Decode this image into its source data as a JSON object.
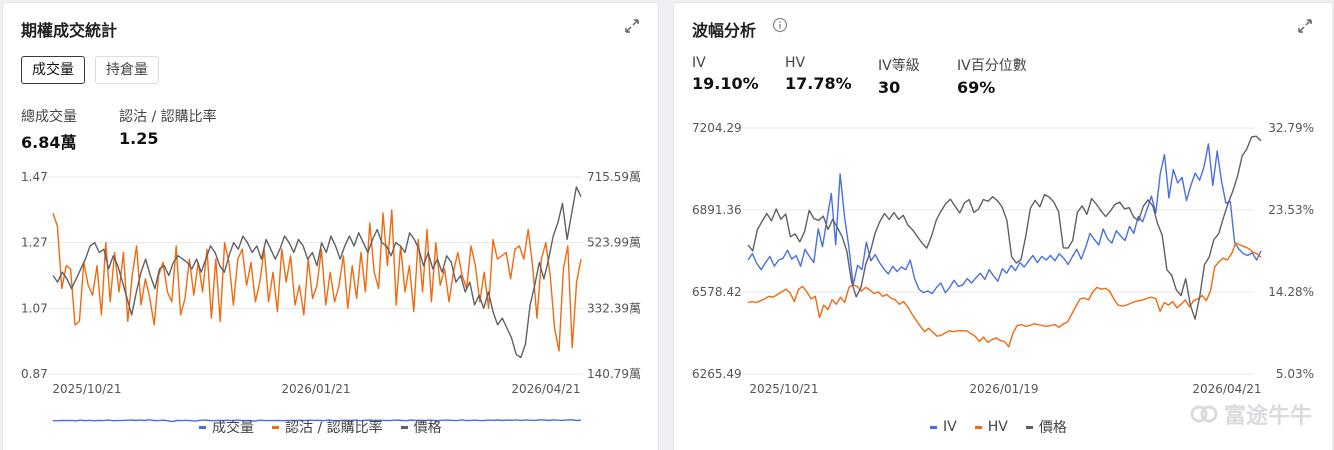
{
  "left": {
    "title": "期權成交統計",
    "tabs": [
      {
        "label": "成交量",
        "active": true
      },
      {
        "label": "持倉量",
        "active": false
      }
    ],
    "stats": [
      {
        "label": "總成交量",
        "value": "6.84萬"
      },
      {
        "label": "認沽 / 認購比率",
        "value": "1.25"
      }
    ],
    "legend": [
      "成交量",
      "認沽 / 認購比率",
      "價格"
    ]
  },
  "right": {
    "title": "波幅分析",
    "stats": [
      {
        "label": "IV",
        "value": "19.10%"
      },
      {
        "label": "HV",
        "value": "17.78%"
      },
      {
        "label": "IV等級",
        "value": "30"
      },
      {
        "label": "IV百分位數",
        "value": "69%"
      }
    ],
    "legend": [
      "IV",
      "HV",
      "價格"
    ]
  },
  "watermark": "富途牛牛",
  "colors": {
    "blue": "#4a6fe3",
    "orange": "#f06a0f",
    "gray": "#5d6166"
  },
  "chart_data": [
    {
      "type": "line",
      "x_ticks": [
        "2025/10/21",
        "2026/01/21",
        "2026/04/21"
      ],
      "y_left_ticks": [
        "1.47",
        "1.27",
        "1.07",
        "0.87"
      ],
      "y_right_ticks": [
        "715.59萬",
        "523.99萬",
        "332.39萬",
        "140.79萬"
      ],
      "series": [
        {
          "name": "成交量",
          "color": "#4a6fe3",
          "axis": "right",
          "values": [
            4.6,
            4.4,
            5.1,
            4.9,
            5.3,
            4.2,
            5.9,
            4.6,
            5.6,
            4.3,
            5.2,
            4.9,
            6.2,
            4.5,
            4.7,
            5.4,
            5.8,
            6.3,
            5.2,
            6.4,
            5.0,
            7.3,
            5.1,
            4.8,
            6.0,
            4.1,
            2.0,
            5.3,
            4.9,
            5.6,
            4.5,
            3.4,
            5.7,
            6.2,
            5.0,
            4.5,
            5.5,
            4.8,
            5.9,
            4.6,
            6.0,
            5.3,
            4.5,
            5.1,
            3.0,
            6.0,
            5.2,
            4.7,
            4.8,
            5.5,
            4.6,
            4.8,
            5.2,
            5.3,
            5.6,
            4.7,
            6.0,
            5.1,
            5.6,
            4.6,
            6.3,
            4.8,
            4.5,
            5.6,
            5.8,
            5.0,
            6.2,
            4.1,
            5.6,
            6.5,
            4.8,
            6.0,
            5.4,
            4.9,
            5.6,
            6.7,
            5.0,
            4.5,
            6.5,
            5.2,
            5.8,
            4.7,
            6.3,
            5.1,
            4.8,
            5.9,
            6.2,
            5.4,
            4.8,
            6.8,
            4.9,
            5.5,
            6.0,
            4.7,
            5.2,
            6.4,
            5.8,
            6.5,
            5.1,
            6.2,
            5.7,
            6.9,
            5.3,
            6.8,
            5.8,
            5.3,
            7.3,
            6.6,
            5.0,
            7.0,
            6.0,
            5.5,
            6.8,
            7.2,
            5.0,
            6.3
          ]
        },
        {
          "name": "認沽 / 認購比率",
          "color": "#f06a0f",
          "axis": "left",
          "values": [
            1.36,
            1.32,
            1.13,
            1.2,
            1.19,
            1.02,
            1.03,
            1.21,
            1.14,
            1.11,
            1.2,
            1.05,
            1.27,
            1.09,
            1.24,
            1.12,
            1.24,
            1.03,
            1.17,
            1.26,
            1.08,
            1.16,
            1.1,
            1.02,
            1.17,
            1.21,
            1.12,
            1.09,
            1.26,
            1.05,
            1.1,
            1.22,
            1.11,
            1.21,
            1.12,
            1.25,
            1.04,
            1.22,
            1.03,
            1.27,
            1.21,
            1.08,
            1.22,
            1.25,
            1.14,
            1.21,
            1.09,
            1.15,
            1.25,
            1.09,
            1.18,
            1.06,
            1.25,
            1.15,
            1.23,
            1.08,
            1.14,
            1.05,
            1.22,
            1.1,
            1.14,
            1.25,
            1.08,
            1.18,
            1.09,
            1.14,
            1.23,
            1.07,
            1.2,
            1.1,
            1.24,
            1.12,
            1.33,
            1.18,
            1.13,
            1.36,
            1.2,
            1.37,
            1.08,
            1.26,
            1.12,
            1.2,
            1.06,
            1.28,
            1.12,
            1.31,
            1.09,
            1.27,
            1.14,
            1.19,
            1.09,
            1.18,
            1.24,
            1.17,
            1.13,
            1.26,
            1.2,
            1.09,
            1.18,
            1.07,
            1.28,
            1.22,
            1.23,
            1.24,
            1.16,
            1.25,
            1.26,
            1.22,
            1.31,
            1.2,
            1.04,
            1.22,
            1.27,
            1.17,
            1.01,
            0.94,
            1.19,
            1.26,
            0.95,
            1.15,
            1.22
          ]
        },
        {
          "name": "價格",
          "color": "#5d6166",
          "axis": "left",
          "values": [
            1.17,
            1.15,
            1.18,
            1.16,
            1.13,
            1.16,
            1.19,
            1.22,
            1.26,
            1.27,
            1.24,
            1.25,
            1.19,
            1.23,
            1.2,
            1.15,
            1.1,
            1.05,
            1.12,
            1.18,
            1.22,
            1.17,
            1.13,
            1.19,
            1.2,
            1.17,
            1.21,
            1.23,
            1.22,
            1.21,
            1.19,
            1.22,
            1.18,
            1.22,
            1.26,
            1.24,
            1.2,
            1.18,
            1.23,
            1.27,
            1.25,
            1.29,
            1.27,
            1.24,
            1.26,
            1.22,
            1.28,
            1.25,
            1.22,
            1.25,
            1.29,
            1.27,
            1.24,
            1.28,
            1.26,
            1.22,
            1.24,
            1.2,
            1.27,
            1.24,
            1.29,
            1.26,
            1.22,
            1.26,
            1.29,
            1.26,
            1.3,
            1.27,
            1.24,
            1.28,
            1.31,
            1.27,
            1.26,
            1.23,
            1.27,
            1.26,
            1.24,
            1.3,
            1.28,
            1.25,
            1.2,
            1.24,
            1.19,
            1.22,
            1.18,
            1.23,
            1.21,
            1.15,
            1.17,
            1.12,
            1.15,
            1.08,
            1.11,
            1.07,
            1.12,
            1.06,
            1.02,
            1.04,
            1.01,
            0.98,
            0.93,
            0.92,
            0.96,
            1.08,
            1.14,
            1.21,
            1.16,
            1.22,
            1.29,
            1.33,
            1.39,
            1.28,
            1.36,
            1.44,
            1.41
          ]
        }
      ]
    },
    {
      "type": "line",
      "x_ticks": [
        "2025/10/21",
        "2026/01/19",
        "2026/04/21"
      ],
      "y_left_ticks": [
        "7204.29",
        "6891.36",
        "6578.42",
        "6265.49"
      ],
      "y_right_ticks": [
        "32.79%",
        "23.53%",
        "14.28%",
        "5.03%"
      ],
      "series": [
        {
          "name": "IV",
          "color": "#4a6fe3",
          "axis": "right",
          "values": [
            17.9,
            18.6,
            17.5,
            16.8,
            17.6,
            18.3,
            17.2,
            17.9,
            18.1,
            19.0,
            18.0,
            18.4,
            17.2,
            19.1,
            18.3,
            17.6,
            21.4,
            19.4,
            22.4,
            25.4,
            19.6,
            27.6,
            22.8,
            19.4,
            15.1,
            17.3,
            16.8,
            19.9,
            17.8,
            18.5,
            17.6,
            16.9,
            16.3,
            17.2,
            16.6,
            17.1,
            16.8,
            17.9,
            15.8,
            14.6,
            14.2,
            14.4,
            14.1,
            14.8,
            15.3,
            14.2,
            14.8,
            15.6,
            14.9,
            15.1,
            15.8,
            15.3,
            15.9,
            16.4,
            15.7,
            16.8,
            16.1,
            15.5,
            16.9,
            16.4,
            17.3,
            16.7,
            17.6,
            17.1,
            17.8,
            18.4,
            17.6,
            18.3,
            17.9,
            18.4,
            17.8,
            18.6,
            18.1,
            17.4,
            18.3,
            19.1,
            18.0,
            19.3,
            20.9,
            20.2,
            19.6,
            21.4,
            20.3,
            19.8,
            21.2,
            20.6,
            20.1,
            21.7,
            20.9,
            22.8,
            22.2,
            23.6,
            25.1,
            23.2,
            27.6,
            29.8,
            24.9,
            28.1,
            26.6,
            27.2,
            24.6,
            26.3,
            27.7,
            26.9,
            28.4,
            31.0,
            26.3,
            30.2,
            26.8,
            24.3,
            24.5,
            19.8,
            19.1,
            18.6,
            18.4,
            18.7,
            17.9,
            18.9
          ]
        },
        {
          "name": "HV",
          "color": "#f06a0f",
          "axis": "right",
          "values": [
            13.1,
            13.2,
            13.1,
            13.3,
            13.5,
            13.8,
            13.7,
            14.0,
            14.3,
            14.6,
            14.2,
            13.2,
            14.6,
            14.9,
            14.3,
            13.5,
            13.8,
            11.4,
            12.8,
            12.3,
            13.4,
            12.9,
            13.7,
            13.1,
            14.8,
            15.1,
            14.9,
            14.4,
            14.8,
            14.5,
            14.1,
            14.3,
            13.8,
            14.0,
            13.6,
            13.4,
            12.9,
            13.2,
            12.6,
            11.8,
            11.1,
            10.4,
            9.8,
            10.2,
            9.7,
            9.3,
            9.4,
            9.7,
            9.9,
            9.8,
            9.9,
            9.9,
            9.9,
            9.6,
            9.3,
            8.7,
            9.2,
            8.6,
            8.9,
            9.1,
            8.8,
            8.7,
            8.1,
            9.6,
            10.5,
            10.6,
            10.4,
            10.5,
            10.7,
            10.6,
            10.5,
            10.4,
            10.5,
            10.6,
            10.3,
            10.7,
            10.9,
            11.8,
            12.7,
            13.5,
            13.6,
            13.4,
            14.3,
            14.8,
            14.6,
            14.7,
            14.4,
            13.5,
            12.8,
            12.7,
            12.8,
            13.0,
            13.2,
            13.3,
            13.4,
            13.6,
            13.7,
            13.5,
            12.1,
            13.1,
            12.8,
            13.2,
            12.5,
            12.9,
            13.4,
            12.6,
            13.3,
            13.5,
            13.9,
            13.3,
            14.4,
            17.1,
            17.7,
            18.1,
            17.9,
            18.6,
            19.8,
            19.6,
            19.4,
            19.2,
            18.8,
            18.6,
            18.2
          ]
        },
        {
          "name": "價格",
          "color": "#5d6166",
          "axis": "left",
          "values": [
            6758,
            6735,
            6817,
            6848,
            6878,
            6850,
            6895,
            6856,
            6876,
            6789,
            6800,
            6770,
            6808,
            6890,
            6858,
            6852,
            6868,
            6817,
            6856,
            6824,
            6790,
            6735,
            6618,
            6560,
            6596,
            6684,
            6733,
            6803,
            6847,
            6878,
            6855,
            6882,
            6856,
            6871,
            6833,
            6815,
            6790,
            6765,
            6746,
            6793,
            6853,
            6887,
            6915,
            6933,
            6906,
            6880,
            6919,
            6931,
            6882,
            6895,
            6931,
            6925,
            6942,
            6927,
            6903,
            6852,
            6713,
            6689,
            6702,
            6790,
            6898,
            6928,
            6903,
            6950,
            6941,
            6921,
            6885,
            6747,
            6746,
            6775,
            6883,
            6907,
            6875,
            6935,
            6914,
            6888,
            6866,
            6888,
            6913,
            6921,
            6896,
            6900,
            6863,
            6851,
            6906,
            6930,
            6907,
            6840,
            6795,
            6663,
            6643,
            6587,
            6565,
            6629,
            6528,
            6475,
            6563,
            6683,
            6712,
            6779,
            6800,
            6860,
            6917,
            6963,
            7020,
            7098,
            7125,
            7170,
            7173,
            7155
          ]
        }
      ]
    }
  ]
}
